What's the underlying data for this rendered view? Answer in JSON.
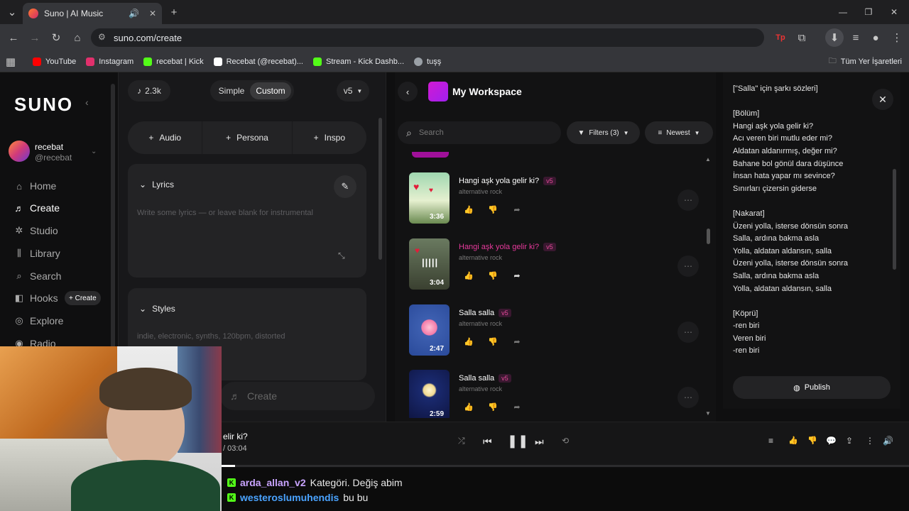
{
  "browser": {
    "tab_title": "Suno | AI Music",
    "url": "suno.com/create",
    "bookmarks": [
      {
        "label": "YouTube",
        "color": "#ff0000"
      },
      {
        "label": "Instagram",
        "color": "#e1306c"
      },
      {
        "label": "recebat | Kick",
        "color": "#53fc18"
      },
      {
        "label": "Recebat (@recebat)...",
        "color": "#ffffff"
      },
      {
        "label": "Stream - Kick Dashb...",
        "color": "#53fc18"
      },
      {
        "label": "tuşş",
        "color": "#9aa0a6"
      }
    ],
    "all_bookmarks": "Tüm Yer İşaretleri"
  },
  "sidebar": {
    "logo": "SUNO",
    "user_name": "recebat",
    "user_handle": "@recebat",
    "items": [
      {
        "label": "Home"
      },
      {
        "label": "Create"
      },
      {
        "label": "Studio"
      },
      {
        "label": "Library"
      },
      {
        "label": "Search"
      },
      {
        "label": "Hooks"
      },
      {
        "label": "Explore"
      },
      {
        "label": "Radio"
      }
    ],
    "hooks_create": "+ Create"
  },
  "create": {
    "credits": "2.3k",
    "mode_simple": "Simple",
    "mode_custom": "Custom",
    "version": "v5",
    "add_audio": "Audio",
    "add_persona": "Persona",
    "add_inspo": "Inspo",
    "lyrics_label": "Lyrics",
    "lyrics_placeholder": "Write some lyrics — or leave blank for instrumental",
    "styles_label": "Styles",
    "styles_placeholder": "indie, electronic, synths, 120bpm, distorted",
    "create_button": "Create"
  },
  "workspace": {
    "title": "My Workspace",
    "search_placeholder": "Search",
    "filters": "Filters (3)",
    "sort": "Newest",
    "songs": [
      {
        "title": "Hangi aşk yola gelir ki?",
        "version": "v5",
        "genre": "alternative rock",
        "duration": "3:36",
        "active": false
      },
      {
        "title": "Hangi aşk yola gelir ki?",
        "version": "v5",
        "genre": "alternative rock",
        "duration": "3:04",
        "active": true
      },
      {
        "title": "Salla salla",
        "version": "v5",
        "genre": "alternative rock",
        "duration": "2:47",
        "active": false
      },
      {
        "title": "Salla salla",
        "version": "v5",
        "genre": "alternative rock",
        "duration": "2:59",
        "active": false
      }
    ]
  },
  "lyrics_panel": {
    "lines": [
      "[\"Salla\" için şarkı sözleri]",
      "",
      "[Bölüm]",
      "Hangi aşk yola gelir ki?",
      "Acı veren biri mutlu eder mi?",
      "Aldatan aldanırmış, değer mi?",
      "Bahane bol gönül dara düşünce",
      "İnsan hata yapar mı sevince?",
      "Sınırları çizersin giderse",
      "",
      "[Nakarat]",
      "Üzeni yolla, isterse dönsün sonra",
      "Salla, ardına bakma asla",
      "Yolla, aldatan aldansın, salla",
      "Üzeni yolla, isterse dönsün sonra",
      "Salla, ardına bakma asla",
      "Yolla, aldatan aldansın, salla",
      "",
      "[Köprü]",
      "-ren biri",
      "Veren biri",
      "-ren biri"
    ],
    "publish": "Publish"
  },
  "player": {
    "title_partial": "elir ki?",
    "time_partial": "/ 03:04",
    "progress": 0.02
  },
  "chat": [
    {
      "user": "arda_allan_v2",
      "user_color": "#c9a4ff",
      "message": "Kategöri. Değiş abim"
    },
    {
      "user": "westeroslumuhendis",
      "user_color": "#4aa3ff",
      "message": "bu bu"
    }
  ]
}
